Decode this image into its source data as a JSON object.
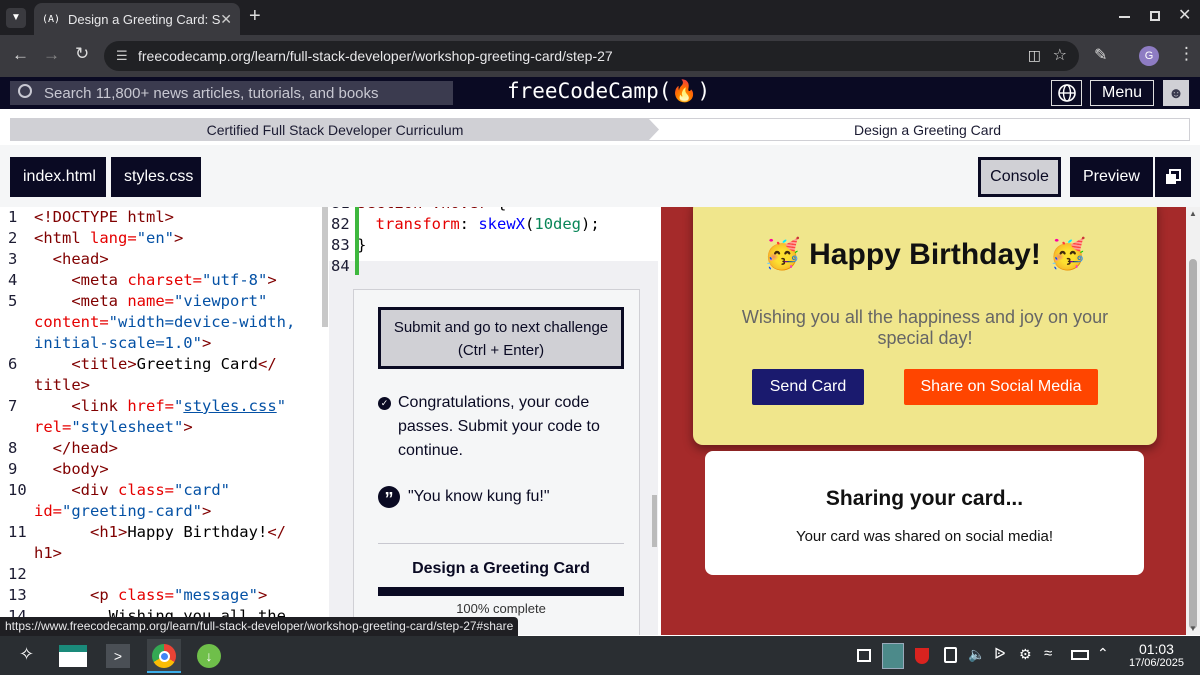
{
  "browser": {
    "tab_favicon": "(A)",
    "tab_title": "Design a Greeting Card: Ste",
    "url": "freecodecamp.org/learn/full-stack-developer/workshop-greeting-card/step-27",
    "profile_initial": "G",
    "status_url": "https://www.freecodecamp.org/learn/full-stack-developer/workshop-greeting-card/step-27#share"
  },
  "fcc_nav": {
    "search_placeholder": "Search 11,800+ news articles, tutorials, and books",
    "logo": "freeCodeCamp(A)",
    "menu_label": "Menu"
  },
  "breadcrumb": {
    "curriculum": "Certified Full Stack Developer Curriculum",
    "project": "Design a Greeting Card"
  },
  "file_tabs": [
    "index.html",
    "styles.css"
  ],
  "right_buttons": {
    "console": "Console",
    "preview": "Preview"
  },
  "editor": {
    "lines": [
      {
        "n": "1",
        "html": "<span class=\"tg\">&lt;!DOCTYPE html&gt;</span>"
      },
      {
        "n": "2",
        "html": "<span class=\"tg\">&lt;html</span> <span class=\"at\">lang=</span><span class=\"vl\">\"en\"</span><span class=\"tg\">&gt;</span>"
      },
      {
        "n": "3",
        "html": "  <span class=\"tg\">&lt;head&gt;</span>"
      },
      {
        "n": "4",
        "html": "    <span class=\"tg\">&lt;meta</span> <span class=\"at\">charset=</span><span class=\"vl\">\"utf-8\"</span><span class=\"tg\">&gt;</span>"
      },
      {
        "n": "5",
        "html": "    <span class=\"tg\">&lt;meta</span> <span class=\"at\">name=</span><span class=\"vl\">\"viewport\"</span>"
      },
      {
        "n": "",
        "html": "<span class=\"at\">content=</span><span class=\"vl\">\"width=device-width,</span>"
      },
      {
        "n": "",
        "html": "<span class=\"vl\">initial-scale=1.0\"</span><span class=\"tg\">&gt;</span>"
      },
      {
        "n": "6",
        "html": "    <span class=\"tg\">&lt;title&gt;</span>Greeting Card<span class=\"tg\">&lt;/</span>"
      },
      {
        "n": "",
        "html": "<span class=\"tg\">title&gt;</span>"
      },
      {
        "n": "7",
        "html": "    <span class=\"tg\">&lt;link</span> <span class=\"at\">href=</span><span class=\"vl\">\"<u>styles.css</u>\"</span>"
      },
      {
        "n": "",
        "html": "<span class=\"at\">rel=</span><span class=\"vl\">\"stylesheet\"</span><span class=\"tg\">&gt;</span>"
      },
      {
        "n": "8",
        "html": "  <span class=\"tg\">&lt;/head&gt;</span>"
      },
      {
        "n": "9",
        "html": "  <span class=\"tg\">&lt;body&gt;</span>"
      },
      {
        "n": "10",
        "html": "    <span class=\"tg\">&lt;div</span> <span class=\"at\">class=</span><span class=\"vl\">\"card\"</span>"
      },
      {
        "n": "",
        "html": "<span class=\"at\">id=</span><span class=\"vl\">\"greeting-card\"</span><span class=\"tg\">&gt;</span>"
      },
      {
        "n": "11",
        "html": "      <span class=\"tg\">&lt;h1&gt;</span>Happy Birthday!<span class=\"tg\">&lt;/</span>"
      },
      {
        "n": "",
        "html": "<span class=\"tg\">h1&gt;</span>"
      },
      {
        "n": "12",
        "html": ""
      },
      {
        "n": "13",
        "html": "      <span class=\"tg\">&lt;p</span> <span class=\"at\">class=</span><span class=\"vl\">\"message\"</span><span class=\"tg\">&gt;</span>"
      },
      {
        "n": "14",
        "html": "        Wishing you all the"
      }
    ]
  },
  "mid_code": [
    {
      "n": "81",
      "html": "<span class=\"tg\">section</span> <span class=\"tg\">.hover</span> {"
    },
    {
      "n": "82",
      "html": "  <span class=\"at\">transform</span>: <span class=\"kw\">skewX</span>(<span style=\"color:#098658\">10deg</span>);"
    },
    {
      "n": "83",
      "html": "}"
    },
    {
      "n": "84",
      "html": ""
    }
  ],
  "panel": {
    "submit_label": "Submit and go to next challenge (Ctrl + Enter)",
    "congrats": "Congratulations, your code passes. Submit your code to continue.",
    "quote": "\"You know kung fu!\"",
    "course_title": "Design a Greeting Card",
    "progress_text": "100% complete",
    "progress_value": 1.0
  },
  "preview": {
    "heading": "Happy Birthday!",
    "emoji": "🥳",
    "message": "Wishing you all the happiness and joy on your special day!",
    "send_label": "Send Card",
    "share_label": "Share on Social Media",
    "share_title": "Sharing your card...",
    "share_text": "Your card was shared on social media!"
  },
  "taskbar": {
    "time": "01:03",
    "date": "17/06/2025"
  },
  "colors": {
    "fcc_dark": "#0a0a23",
    "preview_bg": "#a52a2a",
    "card_bg": "#f0e68c",
    "send_btn": "#1a1a6e",
    "share_btn": "#ff4500"
  }
}
